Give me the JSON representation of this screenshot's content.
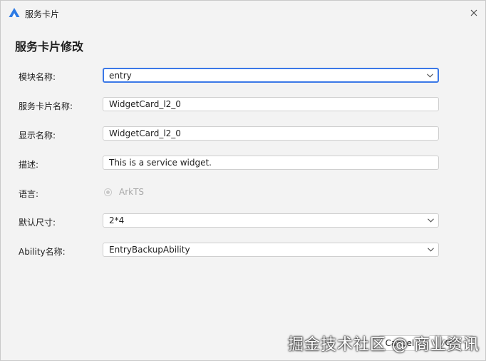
{
  "window": {
    "title": "服务卡片",
    "heading": "服务卡片修改"
  },
  "form": {
    "module": {
      "label": "模块名称:",
      "value": "entry"
    },
    "card_name": {
      "label": "服务卡片名称:",
      "value": "WidgetCard_l2_0"
    },
    "display_name": {
      "label": "显示名称:",
      "value": "WidgetCard_l2_0"
    },
    "description": {
      "label": "描述:",
      "value": "This is a service widget."
    },
    "language": {
      "label": "语言:",
      "option": "ArkTS"
    },
    "size": {
      "label": "默认尺寸:",
      "value": "2*4"
    },
    "ability": {
      "label": "Ability名称:",
      "value": "EntryBackupAbility"
    }
  },
  "footer": {
    "cancel_label": "Cancel",
    "ok_label": "OK",
    "watermark": "掘金技术社区 @ 商业资讯"
  },
  "colors": {
    "accent": "#3b78e7",
    "icon": "#2d7be5"
  }
}
